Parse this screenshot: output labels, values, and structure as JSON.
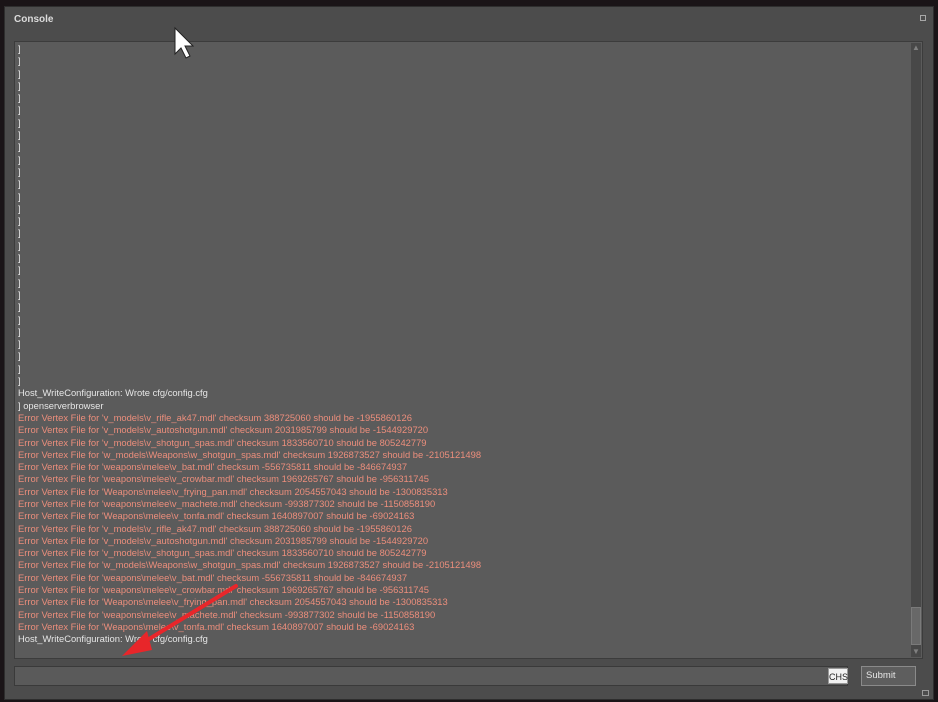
{
  "window": {
    "title": "Console"
  },
  "log_lines": [
    {
      "text": "]",
      "kind": "normal"
    },
    {
      "text": "]",
      "kind": "normal"
    },
    {
      "text": "]",
      "kind": "normal"
    },
    {
      "text": "]",
      "kind": "normal"
    },
    {
      "text": "]",
      "kind": "normal"
    },
    {
      "text": "]",
      "kind": "normal"
    },
    {
      "text": "]",
      "kind": "normal"
    },
    {
      "text": "]",
      "kind": "normal"
    },
    {
      "text": "]",
      "kind": "normal"
    },
    {
      "text": "]",
      "kind": "normal"
    },
    {
      "text": "]",
      "kind": "normal"
    },
    {
      "text": "]",
      "kind": "normal"
    },
    {
      "text": "]",
      "kind": "normal"
    },
    {
      "text": "]",
      "kind": "normal"
    },
    {
      "text": "]",
      "kind": "normal"
    },
    {
      "text": "]",
      "kind": "normal"
    },
    {
      "text": "]",
      "kind": "normal"
    },
    {
      "text": "]",
      "kind": "normal"
    },
    {
      "text": "]",
      "kind": "normal"
    },
    {
      "text": "]",
      "kind": "normal"
    },
    {
      "text": "]",
      "kind": "normal"
    },
    {
      "text": "]",
      "kind": "normal"
    },
    {
      "text": "]",
      "kind": "normal"
    },
    {
      "text": "]",
      "kind": "normal"
    },
    {
      "text": "]",
      "kind": "normal"
    },
    {
      "text": "]",
      "kind": "normal"
    },
    {
      "text": "]",
      "kind": "normal"
    },
    {
      "text": "]",
      "kind": "normal"
    },
    {
      "text": "Host_WriteConfiguration: Wrote cfg/config.cfg",
      "kind": "normal"
    },
    {
      "text": "] openserverbrowser",
      "kind": "normal"
    },
    {
      "text": "Error Vertex File for 'v_models\\v_rifle_ak47.mdl' checksum 388725060 should be -1955860126",
      "kind": "error"
    },
    {
      "text": "Error Vertex File for 'v_models\\v_autoshotgun.mdl' checksum 2031985799 should be -1544929720",
      "kind": "error"
    },
    {
      "text": "Error Vertex File for 'v_models\\v_shotgun_spas.mdl' checksum 1833560710 should be 805242779",
      "kind": "error"
    },
    {
      "text": "Error Vertex File for 'w_models\\Weapons\\w_shotgun_spas.mdl' checksum 1926873527 should be -2105121498",
      "kind": "error"
    },
    {
      "text": "Error Vertex File for 'weapons\\melee\\v_bat.mdl' checksum -556735811 should be -846674937",
      "kind": "error"
    },
    {
      "text": "Error Vertex File for 'weapons\\melee\\v_crowbar.mdl' checksum 1969265767 should be -956311745",
      "kind": "error"
    },
    {
      "text": "Error Vertex File for 'Weapons\\melee\\v_frying_pan.mdl' checksum 2054557043 should be -1300835313",
      "kind": "error"
    },
    {
      "text": "Error Vertex File for 'weapons\\melee\\v_machete.mdl' checksum -993877302 should be -1150858190",
      "kind": "error"
    },
    {
      "text": "Error Vertex File for 'Weapons\\melee\\v_tonfa.mdl' checksum 1640897007 should be -69024163",
      "kind": "error"
    },
    {
      "text": "Error Vertex File for 'v_models\\v_rifle_ak47.mdl' checksum 388725060 should be -1955860126",
      "kind": "error"
    },
    {
      "text": "Error Vertex File for 'v_models\\v_autoshotgun.mdl' checksum 2031985799 should be -1544929720",
      "kind": "error"
    },
    {
      "text": "Error Vertex File for 'v_models\\v_shotgun_spas.mdl' checksum 1833560710 should be 805242779",
      "kind": "error"
    },
    {
      "text": "Error Vertex File for 'w_models\\Weapons\\w_shotgun_spas.mdl' checksum 1926873527 should be -2105121498",
      "kind": "error"
    },
    {
      "text": "Error Vertex File for 'weapons\\melee\\v_bat.mdl' checksum -556735811 should be -846674937",
      "kind": "error"
    },
    {
      "text": "Error Vertex File for 'weapons\\melee\\v_crowbar.mdl' checksum 1969265767 should be -956311745",
      "kind": "error"
    },
    {
      "text": "Error Vertex File for 'Weapons\\melee\\v_frying_pan.mdl' checksum 2054557043 should be -1300835313",
      "kind": "error"
    },
    {
      "text": "Error Vertex File for 'weapons\\melee\\v_machete.mdl' checksum -993877302 should be -1150858190",
      "kind": "error"
    },
    {
      "text": "Error Vertex File for 'Weapons\\melee\\v_tonfa.mdl' checksum 1640897007 should be -69024163",
      "kind": "error"
    },
    {
      "text": "Host_WriteConfiguration: Wrote cfg/config.cfg",
      "kind": "normal"
    }
  ],
  "command": {
    "value": ""
  },
  "ime_indicator": "CHS",
  "submit_label": "Submit",
  "colors": {
    "window_bg": "#4c4c4c",
    "log_bg": "#5b5b5b",
    "normal_text": "#e6e6e6",
    "error_text": "#ec8e7c",
    "annotation_arrow": "#e8262a"
  },
  "icons": {
    "maximize": "maximize-icon",
    "scroll_up": "scroll-up-arrow-icon",
    "scroll_down": "scroll-down-arrow-icon",
    "resize": "resize-grip-icon",
    "cursor": "mouse-cursor-icon",
    "arrow": "red-annotation-arrow-icon"
  }
}
